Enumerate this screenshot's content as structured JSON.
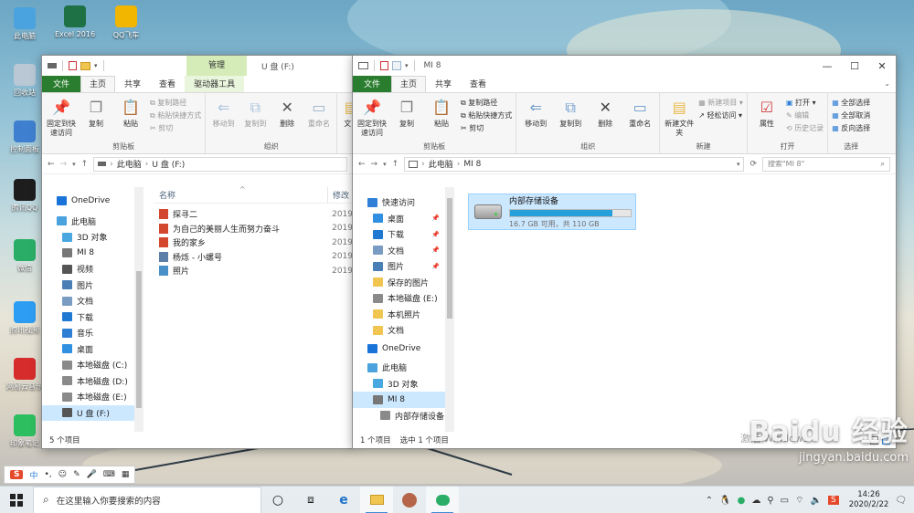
{
  "desktop": {
    "left_icons": [
      {
        "label": "此电脑",
        "color": "#4aa3df"
      },
      {
        "label": "回收站",
        "color": "#b9c8d4"
      },
      {
        "label": "控制面板",
        "color": "#3f7fcf"
      },
      {
        "label": "腾讯QQ",
        "color": "#1d1d1d"
      },
      {
        "label": "微信",
        "color": "#2aae67"
      },
      {
        "label": "腾讯视频",
        "color": "#2d9df3"
      },
      {
        "label": "网易云音乐",
        "color": "#d62c2c"
      },
      {
        "label": "印象笔记",
        "color": "#2dbe60"
      }
    ],
    "top_icons": [
      {
        "label": "Excel 2016",
        "color": "#1e7145"
      },
      {
        "label": "QQ飞车",
        "color": "#f2b500"
      }
    ]
  },
  "left_window": {
    "title": "U 盘 (F:)",
    "context_tab_group": "管理",
    "tabs": [
      "文件",
      "主页",
      "共享",
      "查看",
      "驱动器工具"
    ],
    "active_tab": "主页",
    "ribbon": {
      "clipboard": {
        "pin": "固定到快速访问",
        "copy": "复制",
        "paste": "粘贴",
        "copy_path": "复制路径",
        "paste_shortcut": "粘贴快捷方式",
        "cut": "剪切",
        "label": "剪贴板"
      },
      "organize": {
        "move_to": "移动到",
        "copy_to": "复制到",
        "delete": "删除",
        "rename": "重命名",
        "label": "组织"
      },
      "new_partial": "文"
    },
    "address": {
      "root": "此电脑",
      "current": "U 盘 (F:)"
    },
    "nav": [
      {
        "label": "OneDrive",
        "icon": "cloud-icon",
        "color": "#1a73d9"
      },
      {
        "label": "此电脑",
        "icon": "computer-icon",
        "color": "#4aa3df"
      },
      {
        "label": "3D 对象",
        "icon": "cube-icon",
        "color": "#49a8e0"
      },
      {
        "label": "MI 8",
        "icon": "phone-icon",
        "color": "#777777"
      },
      {
        "label": "视频",
        "icon": "video-icon",
        "color": "#555555"
      },
      {
        "label": "图片",
        "icon": "picture-icon",
        "color": "#4a7fb6"
      },
      {
        "label": "文档",
        "icon": "document-icon",
        "color": "#7a9cc2"
      },
      {
        "label": "下载",
        "icon": "download-icon",
        "color": "#1f78d1"
      },
      {
        "label": "音乐",
        "icon": "music-icon",
        "color": "#2d7fd3"
      },
      {
        "label": "桌面",
        "icon": "desktop-icon",
        "color": "#2f8fe0"
      },
      {
        "label": "本地磁盘 (C:)",
        "icon": "drive-icon",
        "color": "#8a8a8a"
      },
      {
        "label": "本地磁盘 (D:)",
        "icon": "drive-icon",
        "color": "#8a8a8a"
      },
      {
        "label": "本地磁盘 (E:)",
        "icon": "drive-icon",
        "color": "#8a8a8a"
      },
      {
        "label": "U 盘 (F:)",
        "icon": "usb-drive-icon",
        "color": "#555555"
      }
    ],
    "selected_nav": "U 盘 (F:)",
    "columns": {
      "name": "名称",
      "modified": "修改"
    },
    "files": [
      {
        "name": "探寻二",
        "date": "2019",
        "icon": "pdf-file-icon",
        "color": "#d3472f"
      },
      {
        "name": "为自己的美丽人生而努力奋斗",
        "date": "2019",
        "icon": "pdf-file-icon",
        "color": "#d3472f"
      },
      {
        "name": "我的家乡",
        "date": "2019",
        "icon": "pdf-file-icon",
        "color": "#d3472f"
      },
      {
        "name": "杨烁 - 小螺号",
        "date": "2019",
        "icon": "audio-file-icon",
        "color": "#5b7fa8"
      },
      {
        "name": "照片",
        "date": "2019",
        "icon": "image-file-icon",
        "color": "#4a90c8"
      }
    ],
    "status": "5 个项目"
  },
  "right_window": {
    "title": "MI 8",
    "tabs": [
      "文件",
      "主页",
      "共享",
      "查看"
    ],
    "active_tab": "主页",
    "ribbon": {
      "clipboard": {
        "pin": "固定到快速访问",
        "copy": "复制",
        "paste": "粘贴",
        "copy_path": "复制路径",
        "paste_shortcut": "粘贴快捷方式",
        "cut": "剪切",
        "label": "剪贴板"
      },
      "organize": {
        "move_to": "移动到",
        "copy_to": "复制到",
        "delete": "删除",
        "rename": "重命名",
        "label": "组织"
      },
      "new": {
        "new_folder": "新建文件夹",
        "new_item": "新建项目",
        "easy_access": "轻松访问",
        "label": "新建"
      },
      "open": {
        "properties": "属性",
        "open": "打开",
        "edit": "编辑",
        "history": "历史记录",
        "label": "打开"
      },
      "select": {
        "select_all": "全部选择",
        "select_none": "全部取消",
        "invert": "反向选择",
        "label": "选择"
      }
    },
    "address": {
      "root": "此电脑",
      "current": "MI 8"
    },
    "search_placeholder": "搜索\"MI 8\"",
    "nav": [
      {
        "label": "快速访问",
        "icon": "star-icon",
        "color": "#2f7fd6",
        "pinned": false
      },
      {
        "label": "桌面",
        "icon": "desktop-icon",
        "color": "#2f8fe0",
        "pinned": true
      },
      {
        "label": "下载",
        "icon": "download-icon",
        "color": "#1f78d1",
        "pinned": true
      },
      {
        "label": "文档",
        "icon": "document-icon",
        "color": "#7a9cc2",
        "pinned": true
      },
      {
        "label": "图片",
        "icon": "picture-icon",
        "color": "#4a7fb6",
        "pinned": true
      },
      {
        "label": "保存的图片",
        "icon": "folder-icon",
        "color": "#f0c550",
        "pinned": false
      },
      {
        "label": "本地磁盘 (E:)",
        "icon": "drive-icon",
        "color": "#8a8a8a",
        "pinned": false
      },
      {
        "label": "本机照片",
        "icon": "folder-icon",
        "color": "#f0c550",
        "pinned": false
      },
      {
        "label": "文档",
        "icon": "folder-icon",
        "color": "#f0c550",
        "pinned": false
      },
      {
        "label": "OneDrive",
        "icon": "cloud-icon",
        "color": "#1a73d9",
        "pinned": false
      },
      {
        "label": "此电脑",
        "icon": "computer-icon",
        "color": "#4aa3df",
        "pinned": false
      },
      {
        "label": "3D 对象",
        "icon": "cube-icon",
        "color": "#49a8e0",
        "pinned": false
      },
      {
        "label": "MI 8",
        "icon": "phone-icon",
        "color": "#777777",
        "pinned": false
      },
      {
        "label": "内部存储设备",
        "icon": "drive-icon",
        "color": "#8a8a8a",
        "pinned": false
      }
    ],
    "selected_nav": "MI 8",
    "device": {
      "name": "内部存储设备",
      "capacity": "16.7 GB 可用，共 110 GB",
      "used_fraction": 0.848
    },
    "status_count": "1 个项目",
    "status_selected": "选中 1 个项目"
  },
  "watermark": {
    "logo": "Baidu 经验",
    "url": "jingyan.baidu.com"
  },
  "activation_text": "激活 Windows",
  "ime_bar": {
    "brand": "S",
    "lang": "中"
  },
  "taskbar": {
    "search_placeholder": "在这里输入你要搜索的内容",
    "time": "14:26",
    "date": "2020/2/22"
  }
}
